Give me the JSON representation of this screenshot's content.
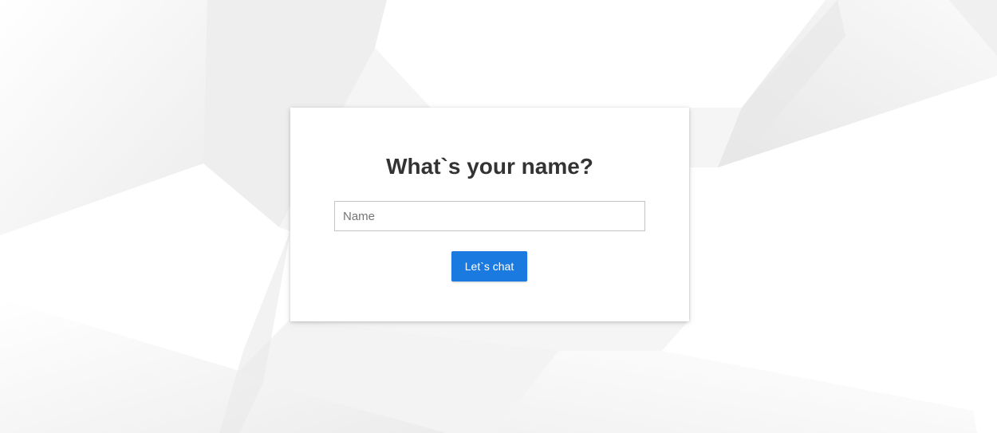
{
  "login": {
    "title": "What`s your name?",
    "name_placeholder": "Name",
    "name_value": "",
    "submit_label": "Let`s chat"
  },
  "colors": {
    "accent": "#1a7ae0",
    "title_text": "#333333",
    "card_background": "#ffffff",
    "page_background": "#f7f7f7"
  }
}
